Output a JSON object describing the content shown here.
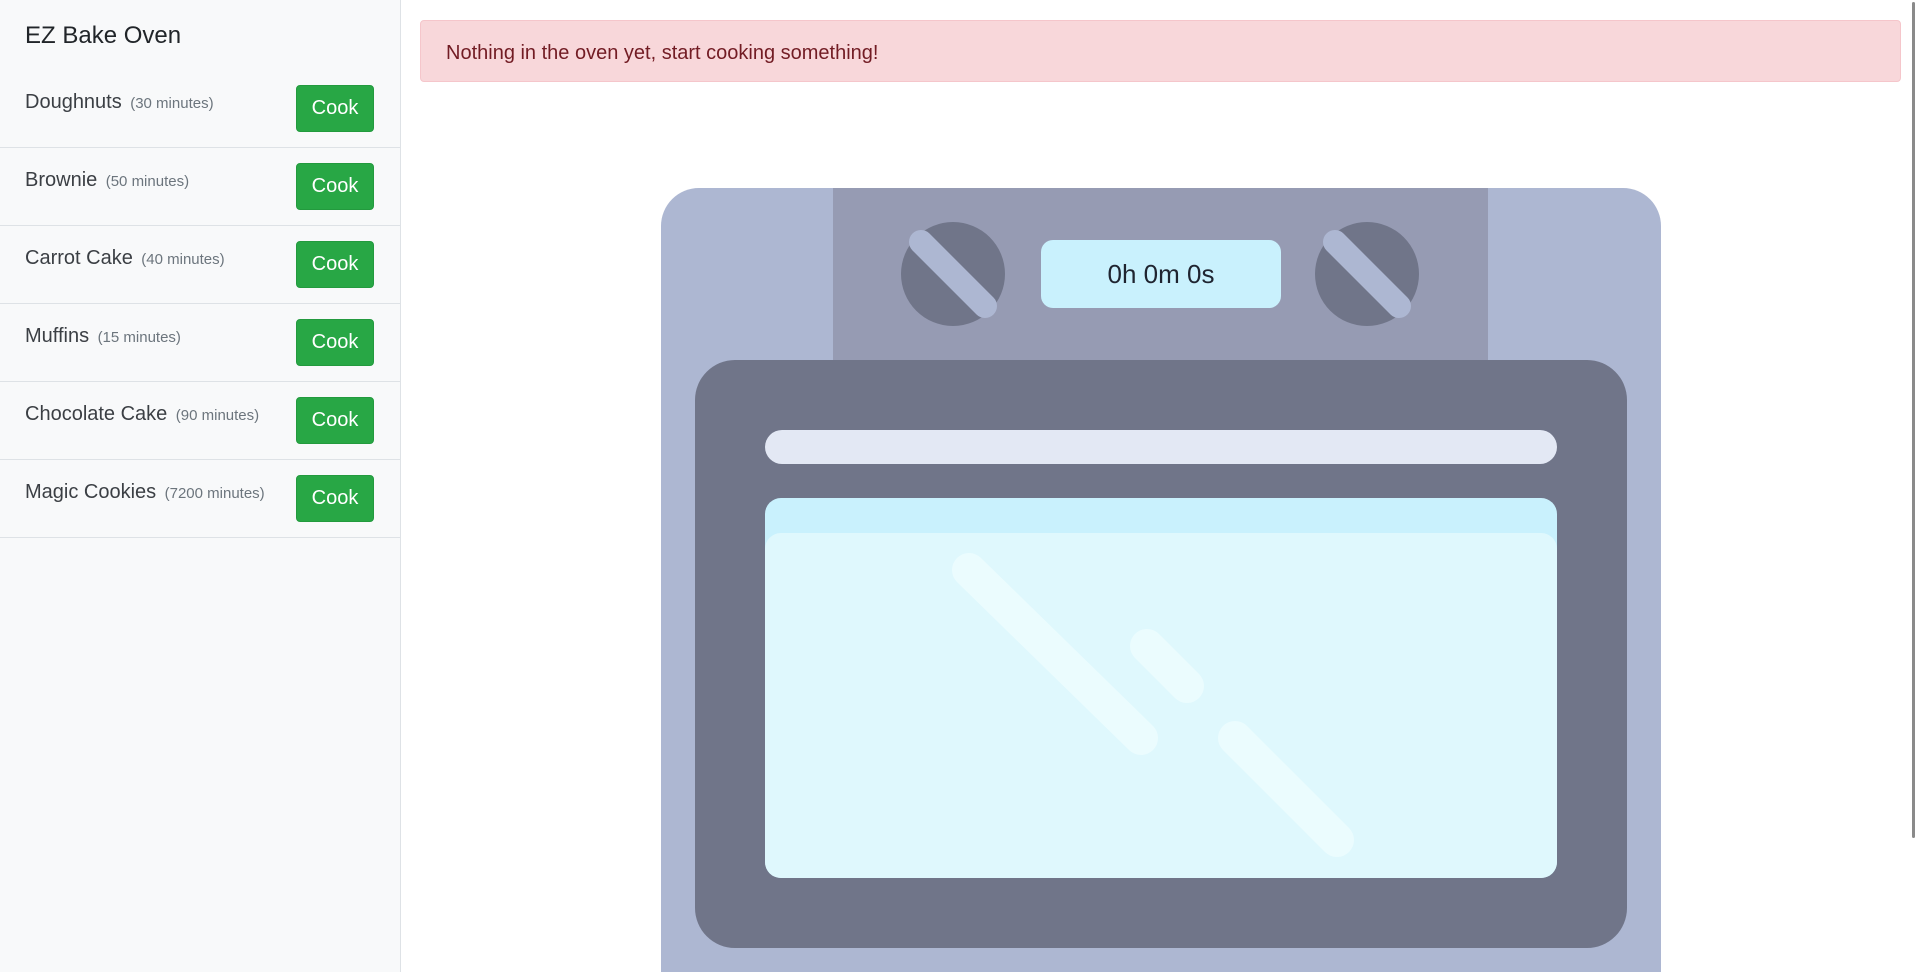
{
  "sidebar": {
    "title": "EZ Bake Oven",
    "recipes": [
      {
        "name": "Doughnuts",
        "duration": "(30 minutes)",
        "button": "Cook"
      },
      {
        "name": "Brownie",
        "duration": "(50 minutes)",
        "button": "Cook"
      },
      {
        "name": "Carrot Cake",
        "duration": "(40 minutes)",
        "button": "Cook"
      },
      {
        "name": "Muffins",
        "duration": "(15 minutes)",
        "button": "Cook"
      },
      {
        "name": "Chocolate Cake",
        "duration": "(90 minutes)",
        "button": "Cook"
      },
      {
        "name": "Magic Cookies",
        "duration": "(7200 minutes)",
        "button": "Cook"
      }
    ]
  },
  "alert": {
    "message": "Nothing in the oven yet, start cooking something!"
  },
  "oven": {
    "timer": "0h 0m 0s"
  },
  "colors": {
    "cook_button": "#28a745",
    "alert_bg": "#f8d7da",
    "alert_text": "#721c24",
    "oven_body": "#adb7d2",
    "oven_panel": "#969bb3",
    "oven_door": "#707589",
    "oven_window": "#dff8fd",
    "timer_bg": "#c9f1fd"
  }
}
